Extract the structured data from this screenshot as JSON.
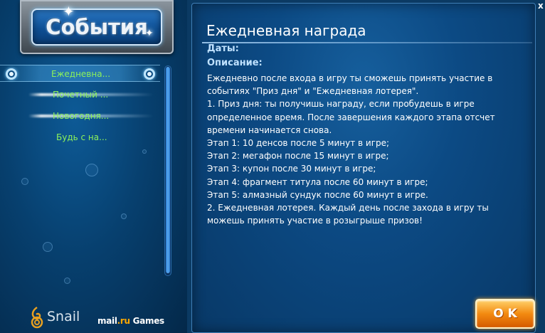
{
  "banner": {
    "title": "События"
  },
  "events": {
    "items": [
      {
        "label": "Ежедневна..."
      },
      {
        "label": "Почетный ..."
      },
      {
        "label": "Новогодня..."
      },
      {
        "label": "Будь с на..."
      }
    ],
    "selected_index": 0
  },
  "logos": {
    "snail": "Snail",
    "mail_a": "mail",
    "mail_b": ".ru",
    "mail_c": " Games"
  },
  "detail": {
    "title": "Ежедневная награда",
    "dates_label": "Даты:",
    "description_label": "Описание:",
    "description_lines": [
      "Ежедневно после входа в игру ты сможешь принять участие в",
      "событиях \"Приз дня\" и \"Ежедневная лотерея\".",
      "1. Приз дня: ты получишь награду, если пробудешь в игре",
      "определенное время. После завершения каждого этапа отсчет",
      "времени начинается снова.",
      "Этап 1: 10 денсов после 5 минут в игре;",
      "Этап 2: мегафон после 15 минут в игре;",
      "Этап 3: купон после 30 минут в игре;",
      "Этап 4: фрагмент титула после 60 минут в игре;",
      "Этап 5: алмазный сундук после 60 минут в игре.",
      "2. Ежедневная лотерея. Каждый день после захода в игру ты",
      "можешь принять участие в розыгрыше призов!"
    ],
    "ok_label": "OK",
    "close_label": "x"
  },
  "colors": {
    "accent_green": "#8cf25a",
    "panel_blue": "#0c4a84",
    "ok_orange": "#f38a10"
  }
}
